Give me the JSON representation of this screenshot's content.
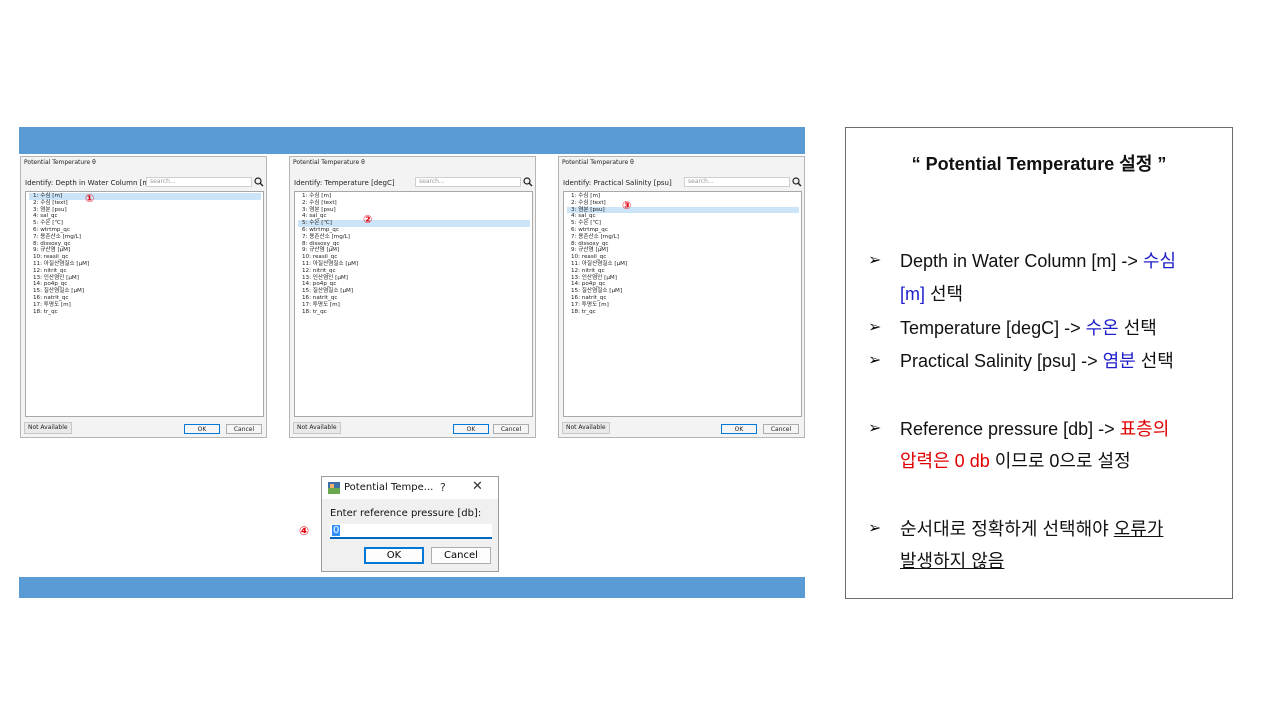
{
  "dialogs": [
    {
      "title": "Potential Temperature θ",
      "identify": "Identify: Depth in Water Column [m]",
      "search_placeholder": "search...",
      "marker": "①",
      "not_available": "Not Available",
      "ok": "OK",
      "cancel": "Cancel",
      "items": [
        "1: 수심 [m]",
        "2: 수심 [text]",
        "3: 염분 [psu]",
        "4: sal_qc",
        "5: 수온 [℃]",
        "6: wtrtmp_qc",
        "7: 용존산소 [mg/L]",
        "8: dissoxy_qc",
        "9: 규산염 [μM]",
        "10: reasil_qc",
        "11: 아질산염질소 [μM]",
        "12: nitrit_qc",
        "13: 인산염인 [μM]",
        "14: po4p_qc",
        "15: 질산염질소 [μM]",
        "16: natrit_qc",
        "17: 투명도 [m]",
        "18: tr_qc"
      ],
      "selected_index": 0
    },
    {
      "title": "Potential Temperature θ",
      "identify": "Identify: Temperature [degC]",
      "search_placeholder": "search...",
      "marker": "②",
      "not_available": "Not Available",
      "ok": "OK",
      "cancel": "Cancel",
      "items": [
        "1: 수심 [m]",
        "2: 수심 [text]",
        "3: 염분 [psu]",
        "4: sal_qc",
        "5: 수온 [℃]",
        "6: wtrtmp_qc",
        "7: 용존산소 [mg/L]",
        "8: dissoxy_qc",
        "9: 규산염 [μM]",
        "10: reasil_qc",
        "11: 아질산염질소 [μM]",
        "12: nitrit_qc",
        "13: 인산염인 [μM]",
        "14: po4p_qc",
        "15: 질산염질소 [μM]",
        "16: natrit_qc",
        "17: 투명도 [m]",
        "18: tr_qc"
      ],
      "selected_index": 4
    },
    {
      "title": "Potential Temperature θ",
      "identify": "Identify: Practical Salinity [psu]",
      "search_placeholder": "search...",
      "marker": "③",
      "not_available": "Not Available",
      "ok": "OK",
      "cancel": "Cancel",
      "items": [
        "1: 수심 [m]",
        "2: 수심 [text]",
        "3: 염분 [psu]",
        "4: sal_qc",
        "5: 수온 [℃]",
        "6: wtrtmp_qc",
        "7: 용존산소 [mg/L]",
        "8: dissoxy_qc",
        "9: 규산염 [μM]",
        "10: reasil_qc",
        "11: 아질산염질소 [μM]",
        "12: nitrit_qc",
        "13: 인산염인 [μM]",
        "14: po4p_qc",
        "15: 질산염질소 [μM]",
        "16: natrit_qc",
        "17: 투명도 [m]",
        "18: tr_qc"
      ],
      "selected_index": 2
    }
  ],
  "pressure_dialog": {
    "title": "Potential Tempe...",
    "help": "?",
    "close": "✕",
    "label": "Enter reference pressure [db]:",
    "value": "0",
    "ok": "OK",
    "cancel": "Cancel",
    "marker": "④"
  },
  "notes": {
    "title": "“ Potential Temperature 설정 ”",
    "bullet": "➢",
    "b1_a": "Depth in Water Column [m] -> ",
    "b1_b": "수심",
    "b1_c": "[m]",
    "b1_d": " 선택",
    "b2_a": "Temperature [degC] -> ",
    "b2_b": "수온",
    "b2_c": " 선택",
    "b3_a": "Practical Salinity [psu] -> ",
    "b3_b": "염분",
    "b3_c": " 선택",
    "b4_a": "Reference pressure [db] -> ",
    "b4_b": "표층의",
    "b4_c": "압력은 0 db",
    "b4_d": " 이므로 0으로 설정",
    "b5_a": "순서대로 정확하게 선택해야 ",
    "b5_b": "오류가",
    "b5_c": "발생하지 않음"
  },
  "colors": {
    "band": "#5b9bd5",
    "highlight_blue": "#1f1fcc",
    "highlight_red": "#e00000",
    "marker_red": "#e3000f"
  }
}
